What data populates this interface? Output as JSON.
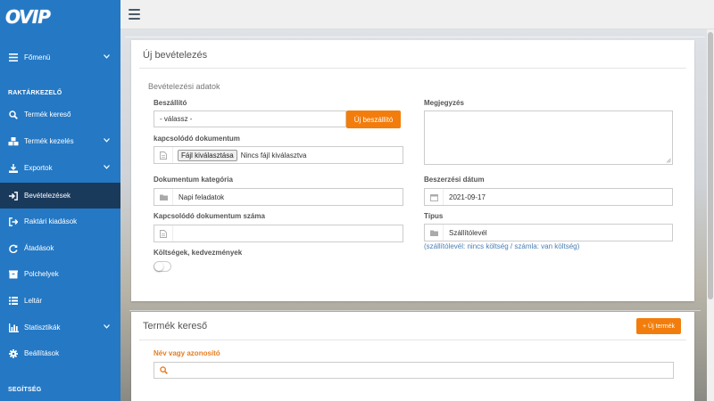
{
  "logo": {
    "text": "OVIP"
  },
  "sidebar": {
    "section_main": "RAKTÁRKEZELŐ",
    "section_help": "SEGÍTSÉG",
    "items": [
      {
        "label": "Főmenü",
        "icon": "menu-icon",
        "has_submenu": true,
        "active": false
      },
      {
        "label": "Termék kereső",
        "icon": "search-icon",
        "has_submenu": false,
        "active": false
      },
      {
        "label": "Termék kezelés",
        "icon": "cubes-icon",
        "has_submenu": true,
        "active": false
      },
      {
        "label": "Exportok",
        "icon": "download-icon",
        "has_submenu": true,
        "active": false
      },
      {
        "label": "Bevételezések",
        "icon": "sign-in-icon",
        "has_submenu": false,
        "active": true
      },
      {
        "label": "Raktári kiadások",
        "icon": "sign-out-icon",
        "has_submenu": false,
        "active": false
      },
      {
        "label": "Átadások",
        "icon": "refresh-icon",
        "has_submenu": false,
        "active": false
      },
      {
        "label": "Polchelyek",
        "icon": "box-icon",
        "has_submenu": false,
        "active": false
      },
      {
        "label": "Leltár",
        "icon": "list-icon",
        "has_submenu": false,
        "active": false
      },
      {
        "label": "Statisztikák",
        "icon": "bar-chart-icon",
        "has_submenu": true,
        "active": false
      },
      {
        "label": "Beállítások",
        "icon": "gear-icon",
        "has_submenu": false,
        "active": false
      }
    ]
  },
  "form": {
    "title": "Új bevételezés",
    "subtitle": "Bevételezési adatok",
    "supplier_label": "Beszállító",
    "supplier_value": "- válassz -",
    "new_supplier_button": "Új beszállító",
    "related_doc_label": "kapcsolódó dokumentum",
    "file_button": "Fájl kiválasztása",
    "file_none": "Nincs fájl kiválasztva",
    "doc_category_label": "Dokumentum kategória",
    "doc_category_value": "Napi feladatok",
    "related_doc_number_label": "Kapcsolódó dokumentum száma",
    "related_doc_number_value": "",
    "costs_label": "Költségek, kedvezmények",
    "costs_enabled": false,
    "note_label": "Megjegyzés",
    "note_value": "",
    "purchase_date_label": "Beszerzési dátum",
    "purchase_date_value": "2021-09-17",
    "type_label": "Típus",
    "type_value": "Szállítólevél",
    "type_hint": "(szállítólevél: nincs költség / számla: van költség)"
  },
  "product_search": {
    "title": "Termék kereső",
    "new_product_button": "+ Új termék",
    "name_label": "Név vagy azonosító",
    "name_value": ""
  },
  "colors": {
    "sidebar": "#2478c4",
    "sidebar_active": "#1a3a5c",
    "accent_orange": "#f27d0c"
  }
}
